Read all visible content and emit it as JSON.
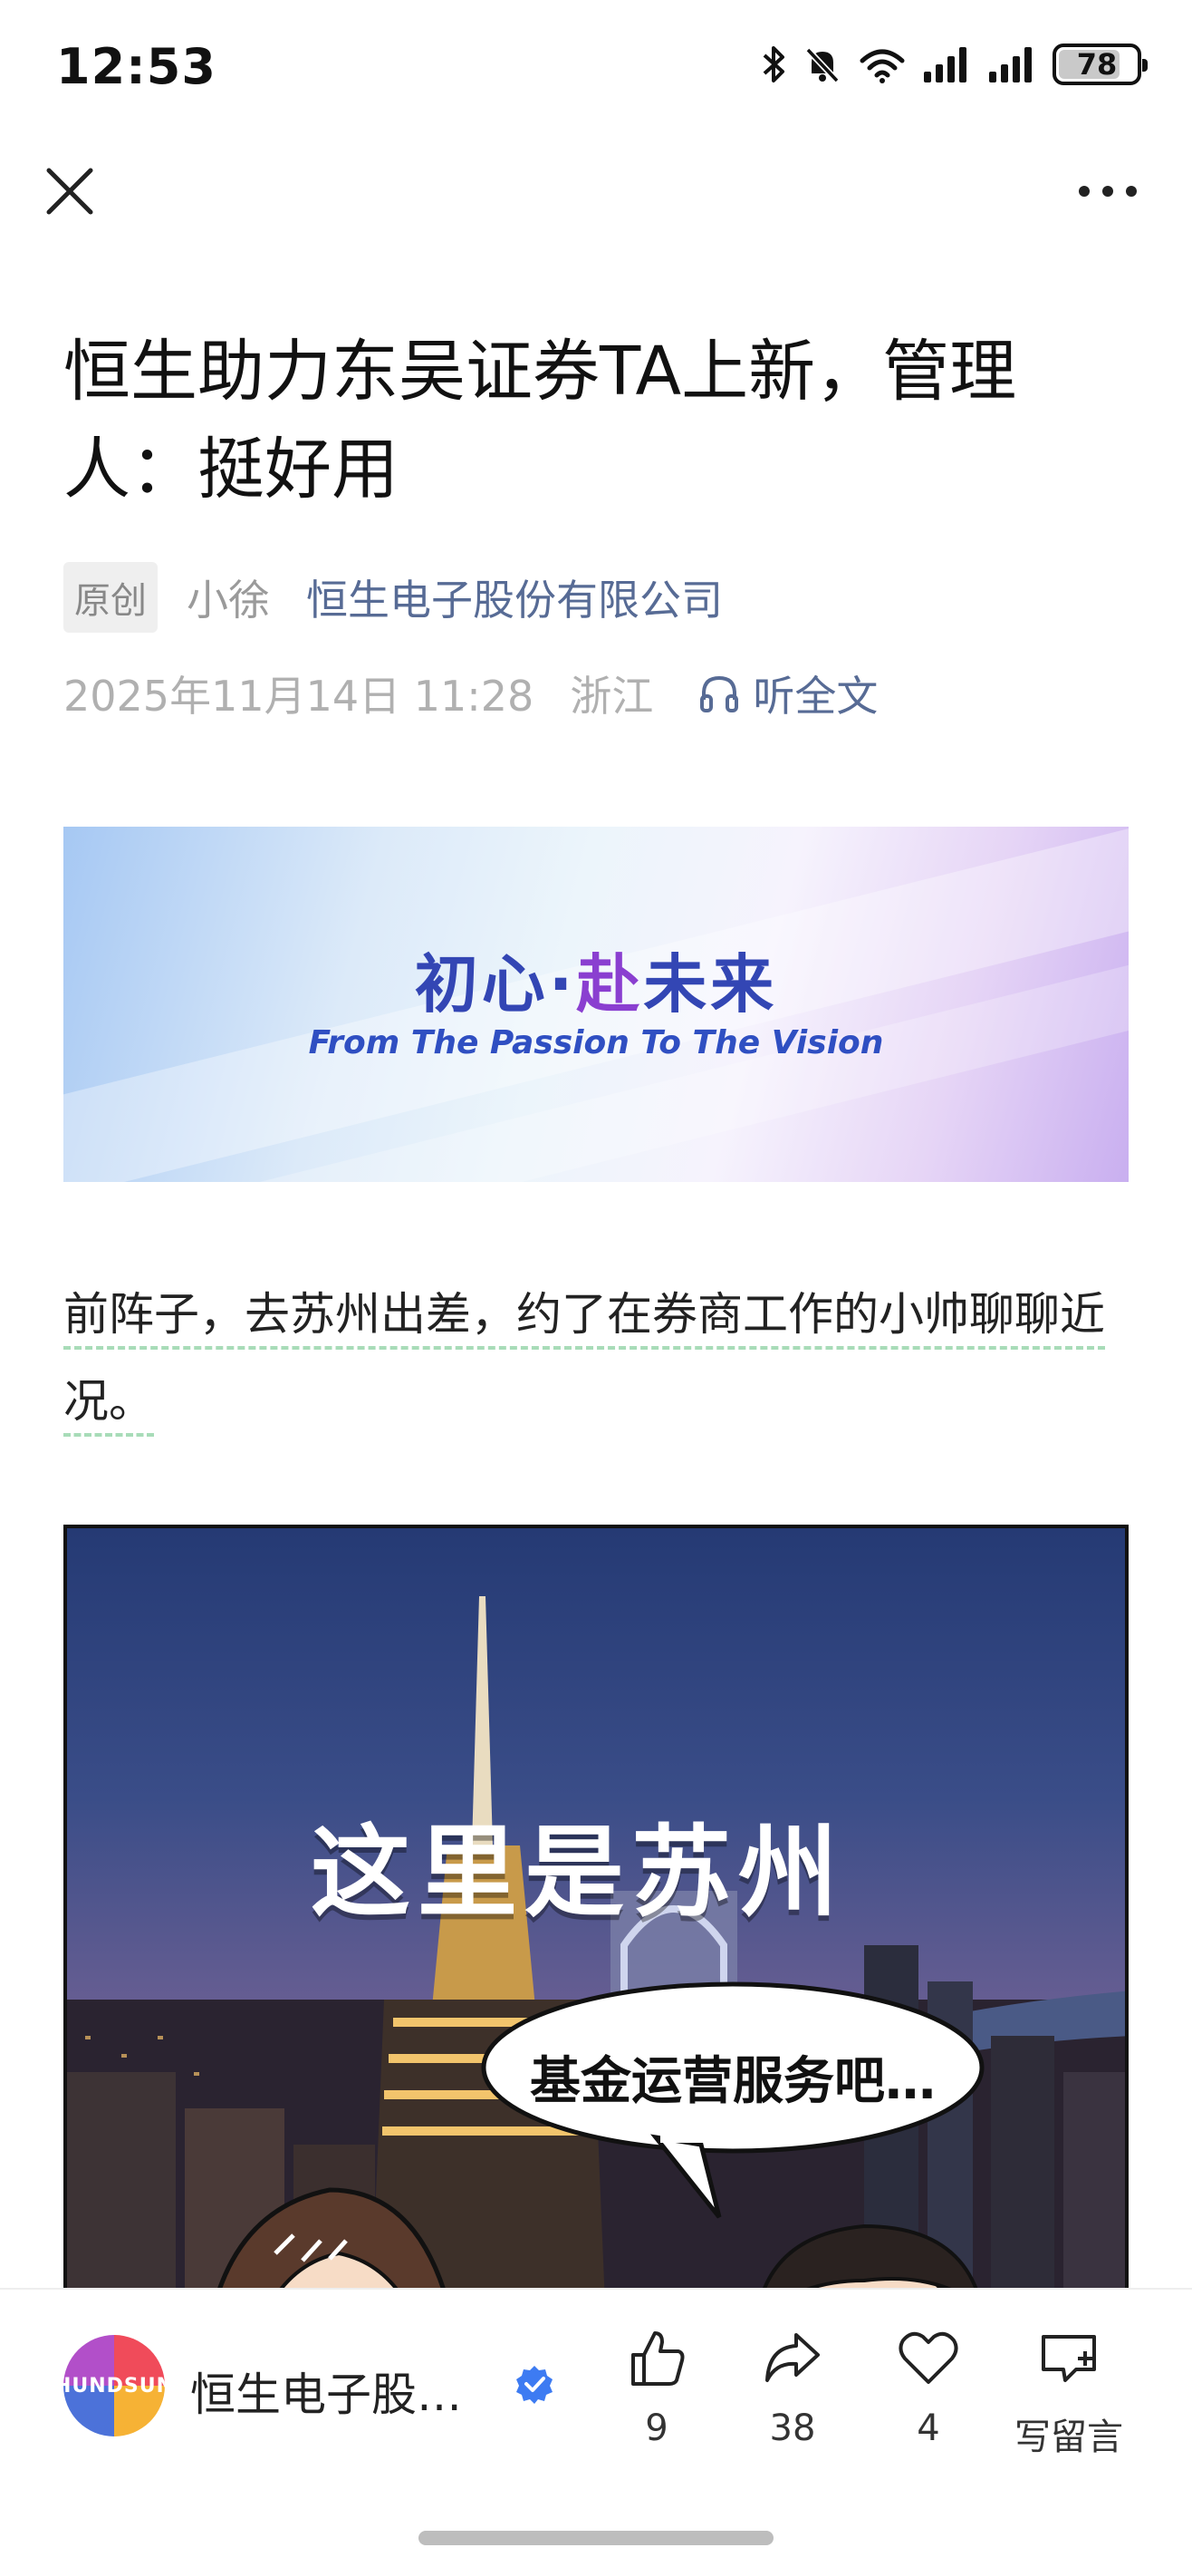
{
  "status_bar": {
    "time": "12:53",
    "battery": "78",
    "battery_level_percent": 78,
    "icons": [
      "bluetooth-icon",
      "mute-bell-icon",
      "wifi-icon",
      "cell-signal-icon",
      "cell-signal-icon",
      "battery-icon"
    ]
  },
  "nav": {
    "close_icon": "close-icon",
    "more_icon": "more-icon"
  },
  "article": {
    "title": "恒生助力东吴证券TA上新，管理人：挺好用",
    "original_tag": "原创",
    "author": "小徐",
    "account": "恒生电子股份有限公司",
    "datetime": "2025年11月14日 11:28",
    "location": "浙江",
    "listen_label": "听全文",
    "banner": {
      "cn_main": "初心·",
      "cn_accent": "赴",
      "cn_rest": "未来",
      "en": "From The Passion To The Vision"
    },
    "paragraph": "前阵子，去苏州出差，约了在券商工作的小帅聊聊近况。",
    "comic": {
      "caption": "这里是苏州",
      "bubble": "基金运营服务吧…"
    }
  },
  "bottom_bar": {
    "avatar_text": "HUNDSUN",
    "account_name": "恒生电子股…",
    "like_count": "9",
    "share_count": "38",
    "favorite_count": "4",
    "comment_label": "写留言"
  },
  "colors": {
    "link": "#576b95",
    "muted": "#b0b0b0",
    "verified": "#3d7bf2"
  }
}
